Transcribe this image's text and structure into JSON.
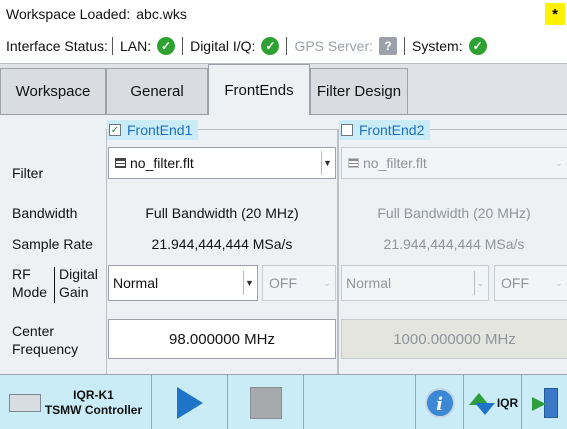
{
  "status": {
    "workspace_label": "Workspace Loaded:",
    "workspace_file": "abc.wks",
    "star": "*",
    "interface_label": "Interface Status:",
    "lan_label": "LAN:",
    "digital_iq_label": "Digital I/Q:",
    "gps_label": "GPS Server:",
    "system_label": "System:"
  },
  "tabs": [
    {
      "label": "Workspace"
    },
    {
      "label": "General"
    },
    {
      "label": "FrontEnds"
    },
    {
      "label": "Filter Design"
    }
  ],
  "labels": {
    "filter": "Filter",
    "bandwidth": "Bandwidth",
    "sample_rate": "Sample Rate",
    "rf": "RF",
    "mode": "Mode",
    "digital": "Digital",
    "gain": "Gain",
    "center": "Center",
    "frequency": "Frequency"
  },
  "frontends": [
    {
      "title": "FrontEnd1",
      "checked": true,
      "filter": "no_filter.flt",
      "bandwidth": "Full Bandwidth (20 MHz)",
      "sample_rate": "21.944,444,444 MSa/s",
      "rf_mode": "Normal",
      "digital_gain": "OFF",
      "center_frequency": "98.000000 MHz"
    },
    {
      "title": "FrontEnd2",
      "checked": false,
      "filter": "no_filter.flt",
      "bandwidth": "Full Bandwidth (20 MHz)",
      "sample_rate": "21.944,444,444 MSa/s",
      "rf_mode": "Normal",
      "digital_gain": "OFF",
      "center_frequency": "1000.000000 MHz"
    }
  ],
  "bottombar": {
    "tsmw_line1": "IQR-K1",
    "tsmw_line2": "TSMW Controller",
    "iqr_label": "IQR"
  },
  "icons": {
    "status_ok": "green-check-circle",
    "gps_status": "gray-question-square",
    "play": "blue-triangle",
    "stop": "gray-square",
    "info": "blue-info-circle",
    "exit": "door-with-arrow"
  }
}
